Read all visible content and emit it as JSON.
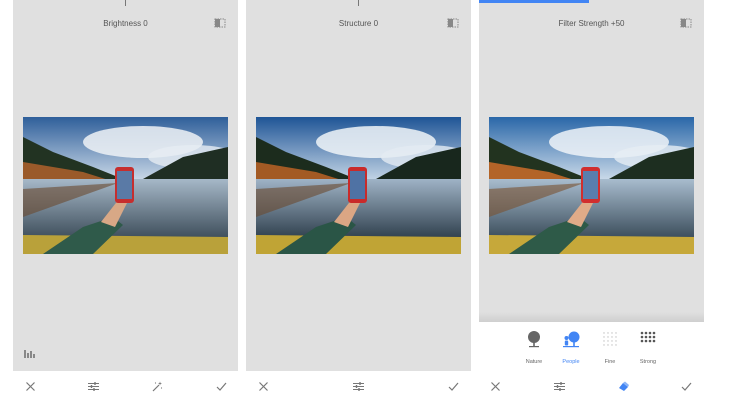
{
  "panels": [
    {
      "title": "Brightness 0"
    },
    {
      "title": "Structure 0"
    },
    {
      "title": "Filter Strength +50"
    }
  ],
  "presets": [
    {
      "label": "Nature",
      "icon": "tree-icon",
      "active": false
    },
    {
      "label": "People",
      "icon": "people-icon",
      "active": true
    },
    {
      "label": "Fine",
      "icon": "fine-dots-icon",
      "active": false
    },
    {
      "label": "Strong",
      "icon": "strong-dots-icon",
      "active": false
    }
  ],
  "colors": {
    "accent": "#4285f4",
    "panel_bg": "#e0e0e0",
    "icon_gray": "#777777"
  }
}
